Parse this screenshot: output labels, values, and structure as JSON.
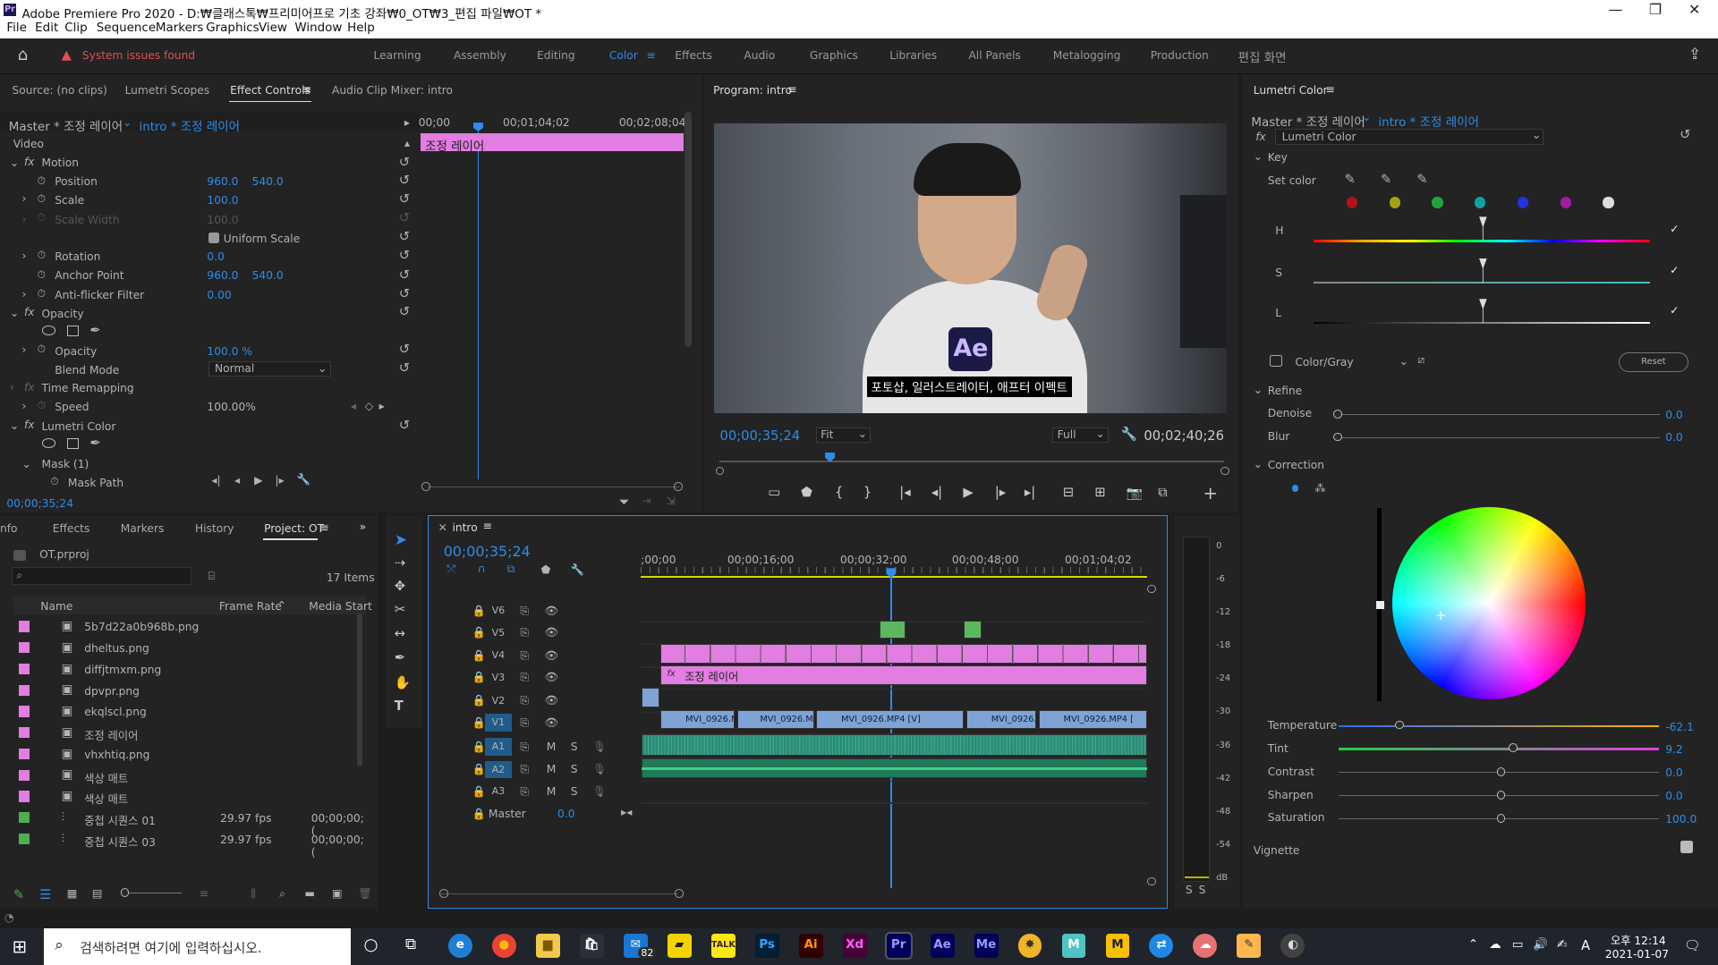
{
  "window": {
    "title": "Adobe Premiere Pro 2020 - D:₩클래스톡₩프리미어프로 기초 강좌₩0_OT₩3_편집 파일₩OT *"
  },
  "menu": [
    "File",
    "Edit",
    "Clip",
    "Sequence",
    "Markers",
    "Graphics",
    "View",
    "Window",
    "Help"
  ],
  "workspace": {
    "alert": "System issues found",
    "tabs": [
      "Learning",
      "Assembly",
      "Editing",
      "Color",
      "Effects",
      "Audio",
      "Graphics",
      "Libraries",
      "All Panels",
      "Metalogging",
      "Production",
      "편집 화면"
    ],
    "active": "Color"
  },
  "source_tabs": [
    "Source: (no clips)",
    "Lumetri Scopes",
    "Effect Controls",
    "Audio Clip Mixer: intro"
  ],
  "effect_controls": {
    "master": "Master * 조정 레이어",
    "clip": "intro * 조정 레이어",
    "ruler": [
      "00;00",
      "00;01;04;02",
      "00;02;08;04"
    ],
    "clip_bar": "조정 레이어",
    "video": "Video",
    "motion": "Motion",
    "position": {
      "label": "Position",
      "x": "960.0",
      "y": "540.0"
    },
    "scale": {
      "label": "Scale",
      "v": "100.0"
    },
    "scale_width": {
      "label": "Scale Width",
      "v": "100.0"
    },
    "uniform": "Uniform Scale",
    "rotation": {
      "label": "Rotation",
      "v": "0.0"
    },
    "anchor": {
      "label": "Anchor Point",
      "x": "960.0",
      "y": "540.0"
    },
    "antiflicker": {
      "label": "Anti-flicker Filter",
      "v": "0.00"
    },
    "opacity_grp": "Opacity",
    "opacity": {
      "label": "Opacity",
      "v": "100.0 %"
    },
    "blend": {
      "label": "Blend Mode",
      "v": "Normal"
    },
    "time_remap": "Time Remapping",
    "speed": {
      "label": "Speed",
      "v": "100.00%"
    },
    "lumetri": "Lumetri Color",
    "mask": "Mask (1)",
    "mask_path": "Mask Path",
    "timecode": "00;00;35;24"
  },
  "program": {
    "title": "Program: intro",
    "caption": "포토샵, 일러스트레이터, 애프터 이펙트",
    "ae": "Ae",
    "timecode": "00;00;35;24",
    "fit": "Fit",
    "full": "Full",
    "duration": "00;02;40;26"
  },
  "project": {
    "tabs": [
      "nfo",
      "Effects",
      "Markers",
      "History",
      "Project: OT"
    ],
    "file": "OT.prproj",
    "items": "17 Items",
    "cols": [
      "Name",
      "Frame Rate",
      "Media Start"
    ],
    "rows": [
      {
        "name": "5b7d22a0b968b.png",
        "color": "#e27de2",
        "fr": "",
        "ms": ""
      },
      {
        "name": "dheltus.png",
        "color": "#e27de2",
        "fr": "",
        "ms": ""
      },
      {
        "name": "diffjtmxm.png",
        "color": "#e27de2",
        "fr": "",
        "ms": ""
      },
      {
        "name": "dpvpr.png",
        "color": "#e27de2",
        "fr": "",
        "ms": ""
      },
      {
        "name": "ekqlscl.png",
        "color": "#e27de2",
        "fr": "",
        "ms": ""
      },
      {
        "name": "조정 레이어",
        "color": "#e27de2",
        "fr": "",
        "ms": ""
      },
      {
        "name": "vhxhtiq.png",
        "color": "#e27de2",
        "fr": "",
        "ms": ""
      },
      {
        "name": "색상 매트",
        "color": "#e27de2",
        "fr": "",
        "ms": ""
      },
      {
        "name": "색상 매트",
        "color": "#e27de2",
        "fr": "",
        "ms": ""
      },
      {
        "name": "중첩 시퀀스 01",
        "color": "#4caf50",
        "fr": "29.97 fps",
        "ms": "00;00;00;("
      },
      {
        "name": "중첩 시퀀스 03",
        "color": "#4caf50",
        "fr": "29.97 fps",
        "ms": "00;00;00;("
      }
    ]
  },
  "timeline": {
    "tab": "intro",
    "timecode": "00;00;35;24",
    "ruler": [
      ";00;00",
      "00;00;16;00",
      "00;00;32;00",
      "00;00;48;00",
      "00;01;04;02"
    ],
    "tracks": [
      "V6",
      "V5",
      "V4",
      "V3",
      "V2",
      "V1",
      "A1",
      "A2",
      "A3"
    ],
    "master": "Master",
    "master_val": "0.0",
    "v3_clip": "조정 레이어",
    "v1_clips": [
      "MVI_0926.M",
      "MVI_0926.M",
      "MVI_0926.MP4 [V]",
      "MVI_0926.",
      "MVI_0926.MP4 ["
    ],
    "meter": [
      "0",
      "-6",
      "-12",
      "-18",
      "-24",
      "-30",
      "-36",
      "-42",
      "-48",
      "-54",
      "dB"
    ]
  },
  "lumetri": {
    "title": "Lumetri Color",
    "master": "Master * 조정 레이어",
    "clip": "intro * 조정 레이어",
    "effect": "Lumetri Color",
    "key": "Key",
    "set_color": "Set color",
    "hsl": [
      "H",
      "S",
      "L"
    ],
    "colorgray": "Color/Gray",
    "reset": "Reset",
    "refine": "Refine",
    "denoise": {
      "label": "Denoise",
      "v": "0.0"
    },
    "blur": {
      "label": "Blur",
      "v": "0.0"
    },
    "correction": "Correction",
    "temperature": {
      "label": "Temperature",
      "v": "-62.1"
    },
    "tint": {
      "label": "Tint",
      "v": "9.2"
    },
    "contrast": {
      "label": "Contrast",
      "v": "0.0"
    },
    "sharpen": {
      "label": "Sharpen",
      "v": "0.0"
    },
    "saturation": {
      "label": "Saturation",
      "v": "100.0"
    },
    "vignette": "Vignette"
  },
  "taskbar": {
    "search": "검색하려면 여기에 입력하십시오.",
    "time": "오후 12:14",
    "date": "2021-01-07",
    "badge": "82",
    "lang": "A"
  }
}
